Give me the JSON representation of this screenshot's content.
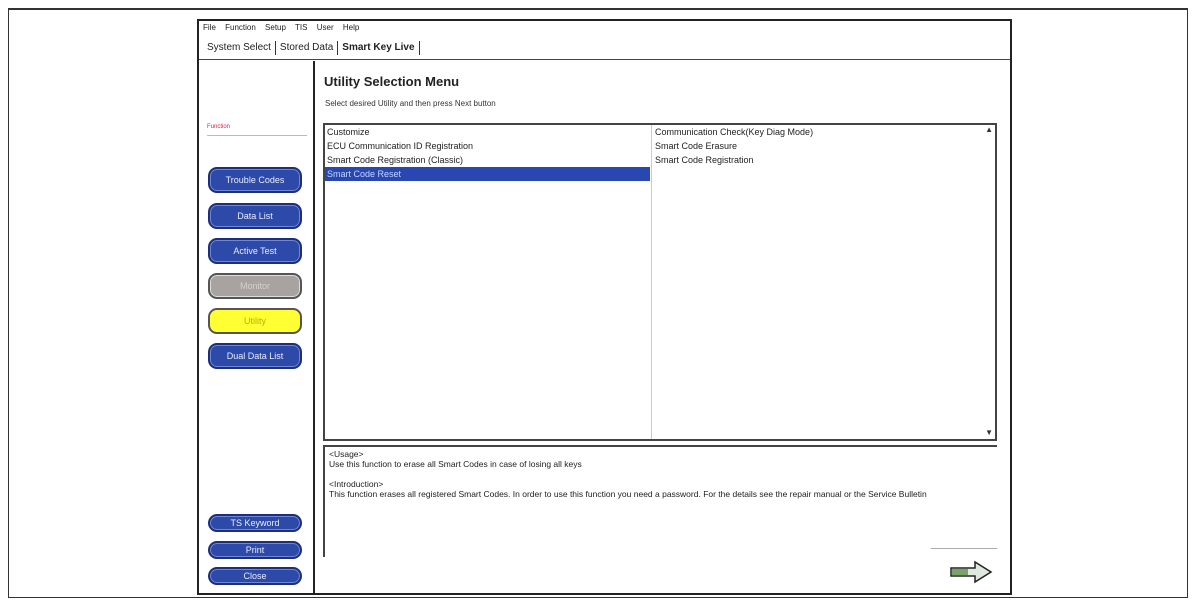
{
  "menubar": {
    "items": [
      "File",
      "Function",
      "Setup",
      "TIS",
      "User",
      "Help"
    ]
  },
  "tabs": [
    {
      "label": "System Select"
    },
    {
      "label": "Stored Data"
    },
    {
      "label": "Smart Key Live"
    }
  ],
  "sidebar": {
    "caption": "Function",
    "buttons": {
      "trouble_codes": "Trouble Codes",
      "data_list": "Data List",
      "active_test": "Active Test",
      "monitor": "Monitor",
      "utility": "Utility",
      "dual_data_list": "Dual Data List",
      "ts_keyword": "TS Keyword",
      "print": "Print",
      "close": "Close"
    }
  },
  "main": {
    "title": "Utility Selection Menu",
    "subtitle": "Select desired Utility and then press Next button",
    "list_left": [
      "Customize",
      "ECU Communication ID Registration",
      "Smart Code Registration (Classic)",
      "Smart Code Reset"
    ],
    "list_right": [
      "Communication Check(Key Diag Mode)",
      "Smart Code Erasure",
      "Smart Code Registration"
    ],
    "selected_index": 3,
    "usage_heading": "<Usage>",
    "usage_text": "Use this function to erase all Smart Codes in case of losing all keys",
    "intro_heading": "<Introduction>",
    "intro_text": "This function erases all registered Smart Codes. In order to use this function you need a password. For the details see the repair manual or the Service Bulletin"
  },
  "icons": {
    "next": "next-arrow-icon",
    "scroll_up": "scroll-up-icon",
    "scroll_down": "scroll-down-icon"
  },
  "colors": {
    "button_blue": "#2e4aa8",
    "selection_blue": "#2847b0",
    "utility_yellow": "#ffff33",
    "monitor_gray": "#a8a2a0",
    "caption_red": "#dd2244"
  }
}
